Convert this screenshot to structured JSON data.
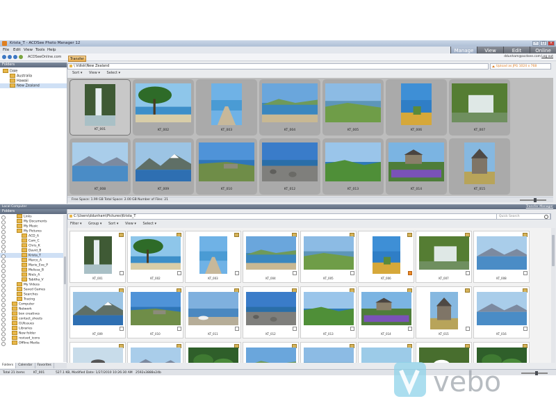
{
  "window": {
    "title": "Krista_T - ACDSee Photo Manager 12"
  },
  "menu": [
    "File",
    "Edit",
    "View",
    "Tools",
    "Help"
  ],
  "modes": [
    {
      "label": "Manage",
      "active": true
    },
    {
      "label": "View",
      "active": false
    },
    {
      "label": "Edit",
      "active": false
    },
    {
      "label": "Online",
      "active": false
    }
  ],
  "nav": {
    "site": "ACDSeeOnline.com",
    "user": "ddunham@acdsee.com",
    "logout": "Log out"
  },
  "top_panel": {
    "tab": "Transfer",
    "pane_title": "Folders",
    "path": "\\ Vdisk\\New Zealand",
    "upload": "Upload as JPG 1024 x 768",
    "toolbar": [
      "Sort ▾",
      "View ▾",
      "Select ▾"
    ],
    "tree": [
      {
        "label": "Dale",
        "depth": 0,
        "selected": false
      },
      {
        "label": "Australia",
        "depth": 1,
        "selected": false
      },
      {
        "label": "Hawaii",
        "depth": 1,
        "selected": false
      },
      {
        "label": "New Zealand",
        "depth": 1,
        "selected": true
      }
    ],
    "thumbnails": [
      {
        "label": "KT_001",
        "scene": "waterfall",
        "orient": "portrait",
        "selected": true
      },
      {
        "label": "KT_002",
        "scene": "tree-lake",
        "orient": "landscape"
      },
      {
        "label": "KT_003",
        "scene": "pier",
        "orient": "portrait"
      },
      {
        "label": "KT_004",
        "scene": "bay",
        "orient": "landscape"
      },
      {
        "label": "KT_005",
        "scene": "hills",
        "orient": "landscape"
      },
      {
        "label": "KT_006",
        "scene": "coast",
        "orient": "portrait"
      },
      {
        "label": "KT_007",
        "scene": "waterfall2",
        "orient": "landscape"
      },
      {
        "label": "KT_008",
        "scene": "lake-mtn",
        "orient": "landscape"
      },
      {
        "label": "KT_009",
        "scene": "mountains",
        "orient": "landscape"
      },
      {
        "label": "KT_010",
        "scene": "cliff",
        "orient": "landscape"
      },
      {
        "label": "KT_012",
        "scene": "rocks",
        "orient": "landscape"
      },
      {
        "label": "KT_013",
        "scene": "green-hills",
        "orient": "landscape"
      },
      {
        "label": "KT_014",
        "scene": "church-lupins",
        "orient": "landscape"
      },
      {
        "label": "KT_015",
        "scene": "church",
        "orient": "portrait"
      }
    ],
    "status": "Free Space: 1.99 GB  Total Space: 2.00 GB  Number of Files: 21"
  },
  "divider": {
    "left": "Local Computer",
    "right": "Transfer Manager"
  },
  "bottom_panel": {
    "pane_title": "Folders",
    "path": "C:\\Users\\ddunham\\Pictures\\Krista_T",
    "toolbar": [
      "Filter ▾",
      "Group ▾",
      "Sort ▾",
      "View ▾",
      "Select ▾"
    ],
    "quick_search": "Quick Search",
    "tree": [
      {
        "label": "Links",
        "depth": 2
      },
      {
        "label": "My Documents",
        "depth": 2
      },
      {
        "label": "My Music",
        "depth": 2
      },
      {
        "label": "My Pictures",
        "depth": 2
      },
      {
        "label": "ACD_A",
        "depth": 3
      },
      {
        "label": "Cam_C",
        "depth": 3
      },
      {
        "label": "Chris_K",
        "depth": 3
      },
      {
        "label": "David_B",
        "depth": 3
      },
      {
        "label": "Krista_T",
        "depth": 3,
        "selected": true
      },
      {
        "label": "Marco_A",
        "depth": 3
      },
      {
        "label": "Marie_Eve_P",
        "depth": 3
      },
      {
        "label": "Melissa_B",
        "depth": 3
      },
      {
        "label": "Niels_A",
        "depth": 3
      },
      {
        "label": "Tabitha_V",
        "depth": 3
      },
      {
        "label": "My Videos",
        "depth": 2
      },
      {
        "label": "Saved Games",
        "depth": 2
      },
      {
        "label": "Searches",
        "depth": 2
      },
      {
        "label": "Tracing",
        "depth": 2
      },
      {
        "label": "Computer",
        "depth": 1
      },
      {
        "label": "Network",
        "depth": 1
      },
      {
        "label": "box creatives",
        "depth": 1
      },
      {
        "label": "contact_sheets",
        "depth": 1
      },
      {
        "label": "GUIissues",
        "depth": 1
      },
      {
        "label": "Libraries",
        "depth": 1
      },
      {
        "label": "New folder",
        "depth": 1
      },
      {
        "label": "revised_icons",
        "depth": 1
      },
      {
        "label": "Offline Media",
        "depth": 1
      }
    ],
    "tabs": [
      {
        "label": "Folders",
        "active": true
      },
      {
        "label": "Calendar",
        "active": false
      },
      {
        "label": "Favorites",
        "active": false
      }
    ],
    "thumbnails": [
      {
        "label": "KT_001",
        "scene": "waterfall",
        "orient": "portrait"
      },
      {
        "label": "KT_002",
        "scene": "tree-lake",
        "orient": "landscape"
      },
      {
        "label": "KT_003",
        "scene": "pier",
        "orient": "portrait"
      },
      {
        "label": "KT_004",
        "scene": "bay",
        "orient": "landscape"
      },
      {
        "label": "KT_005",
        "scene": "hills",
        "orient": "landscape"
      },
      {
        "label": "KT_006",
        "scene": "coast",
        "orient": "portrait",
        "tagged": true
      },
      {
        "label": "KT_007",
        "scene": "waterfall2",
        "orient": "landscape"
      },
      {
        "label": "KT_008",
        "scene": "lake-mtn",
        "orient": "landscape"
      },
      {
        "label": "KT_009",
        "scene": "mountains",
        "orient": "landscape"
      },
      {
        "label": "KT_010",
        "scene": "cliff",
        "orient": "landscape"
      },
      {
        "label": "KT_011",
        "scene": "gull",
        "orient": "landscape"
      },
      {
        "label": "KT_012",
        "scene": "rocks",
        "orient": "landscape"
      },
      {
        "label": "KT_013",
        "scene": "green-hills",
        "orient": "landscape"
      },
      {
        "label": "KT_014",
        "scene": "church-lupins",
        "orient": "landscape"
      },
      {
        "label": "KT_015",
        "scene": "church",
        "orient": "portrait"
      },
      {
        "label": "KT_016",
        "scene": "lake-mtn",
        "orient": "landscape"
      }
    ],
    "partial_row": [
      "bird",
      "lake-mtn",
      "forest",
      "bay",
      "hills",
      "sheep",
      "daisy",
      "forest"
    ]
  },
  "status_bar": {
    "items": [
      "Total 21 items",
      "KT_001",
      "527.1 KB, Modified Date: 1/27/2010 10:26:30 AM",
      "2592x3888x24b"
    ]
  },
  "watermark": {
    "text": "vebo"
  },
  "colors": {
    "accent": "#3d78c3",
    "upload": "#e07d20",
    "grid_top_bg": "#bdbdbd",
    "grid_bot_bg": "#f2f2f2"
  }
}
